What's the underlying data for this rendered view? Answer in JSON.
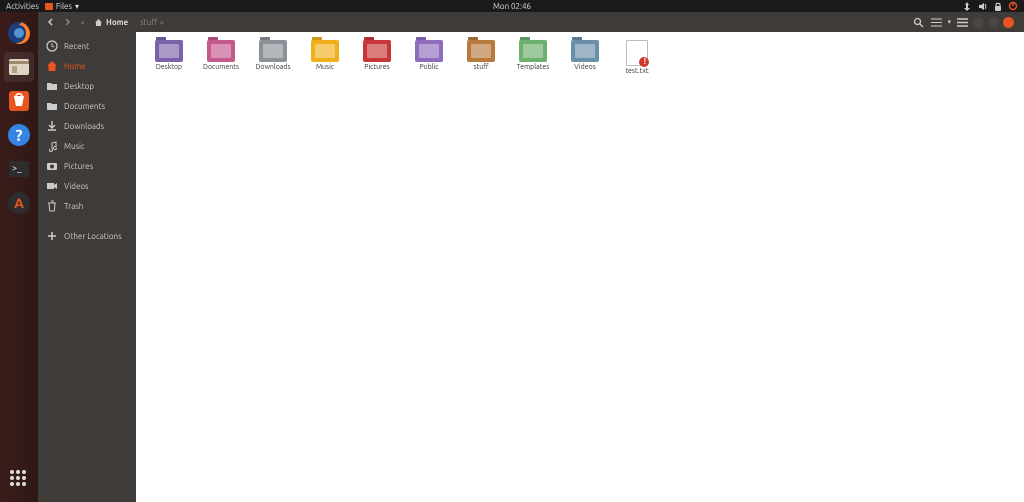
{
  "topbar": {
    "activities": "Activities",
    "app_menu": "Files",
    "clock": "Mon 02:46"
  },
  "dock": {
    "items": [
      {
        "name": "firefox",
        "color": "#ff7f2a"
      },
      {
        "name": "files",
        "color": "#7a6a5e"
      },
      {
        "name": "software",
        "color": "#e95420"
      },
      {
        "name": "help",
        "color": "#3584e4"
      },
      {
        "name": "terminal",
        "color": "#2d2d2d"
      },
      {
        "name": "updater",
        "color": "#2d2d2d"
      }
    ]
  },
  "header": {
    "path": [
      {
        "icon": "home-icon",
        "label": "Home"
      },
      {
        "icon": null,
        "label": "stuff"
      }
    ]
  },
  "sidebar": {
    "items": [
      {
        "icon": "clock-icon",
        "label": "Recent"
      },
      {
        "icon": "home-icon",
        "label": "Home",
        "active": true
      },
      {
        "icon": "folder-icon",
        "label": "Desktop"
      },
      {
        "icon": "folder-icon",
        "label": "Documents"
      },
      {
        "icon": "download-icon",
        "label": "Downloads"
      },
      {
        "icon": "music-icon",
        "label": "Music"
      },
      {
        "icon": "camera-icon",
        "label": "Pictures"
      },
      {
        "icon": "video-icon",
        "label": "Videos"
      },
      {
        "icon": "trash-icon",
        "label": "Trash"
      },
      {
        "icon": "plus-icon",
        "label": "Other Locations"
      }
    ]
  },
  "files": [
    {
      "label": "Desktop",
      "type": "folder",
      "color": "#7a63a8",
      "inner": "display"
    },
    {
      "label": "Documents",
      "type": "folder",
      "color": "#c45a8c",
      "inner": "doc"
    },
    {
      "label": "Downloads",
      "type": "folder",
      "color": "#8a9199",
      "inner": "arrow"
    },
    {
      "label": "Music",
      "type": "folder",
      "color": "#f0b01e",
      "inner": "note"
    },
    {
      "label": "Pictures",
      "type": "folder",
      "color": "#c83737",
      "inner": "cam"
    },
    {
      "label": "Public",
      "type": "folder",
      "color": "#8e6dbd",
      "inner": "share"
    },
    {
      "label": "stuff",
      "type": "folder",
      "color": "#b97a3e",
      "inner": ""
    },
    {
      "label": "Templates",
      "type": "folder",
      "color": "#6eb06e",
      "inner": "tmpl"
    },
    {
      "label": "Videos",
      "type": "folder",
      "color": "#6a8fa8",
      "inner": "vid"
    },
    {
      "label": "test.txt",
      "type": "file"
    }
  ]
}
